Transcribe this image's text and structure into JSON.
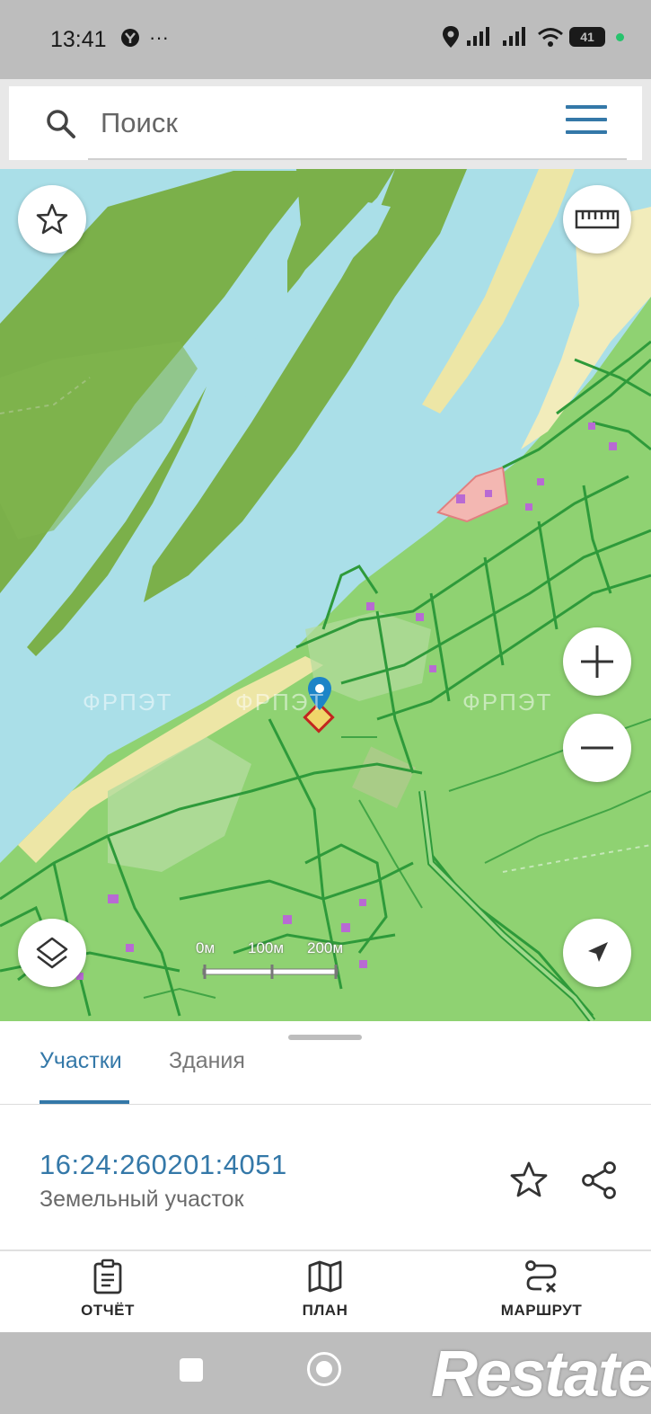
{
  "status_bar": {
    "time": "13:41",
    "more": "···",
    "battery": "41"
  },
  "search": {
    "placeholder": "Поиск"
  },
  "map": {
    "scale_labels": [
      "0м",
      "100м",
      "200м"
    ],
    "watermark": "ФРПЭТ"
  },
  "sheet": {
    "tabs": [
      {
        "label": "Участки",
        "active": true
      },
      {
        "label": "Здания",
        "active": false
      }
    ],
    "parcel": {
      "cadastral_number": "16:24:260201:4051",
      "type": "Земельный участок"
    },
    "actions": [
      {
        "label": "ОТЧЁТ",
        "icon": "report-icon"
      },
      {
        "label": "ПЛАН",
        "icon": "map-icon"
      },
      {
        "label": "МАРШРУТ",
        "icon": "route-icon"
      }
    ]
  },
  "watermark_logo": "Restate",
  "colors": {
    "accent": "#3478a8",
    "water": "#aadfe8",
    "forest": "#7bb04a",
    "land": "#8fd272"
  }
}
